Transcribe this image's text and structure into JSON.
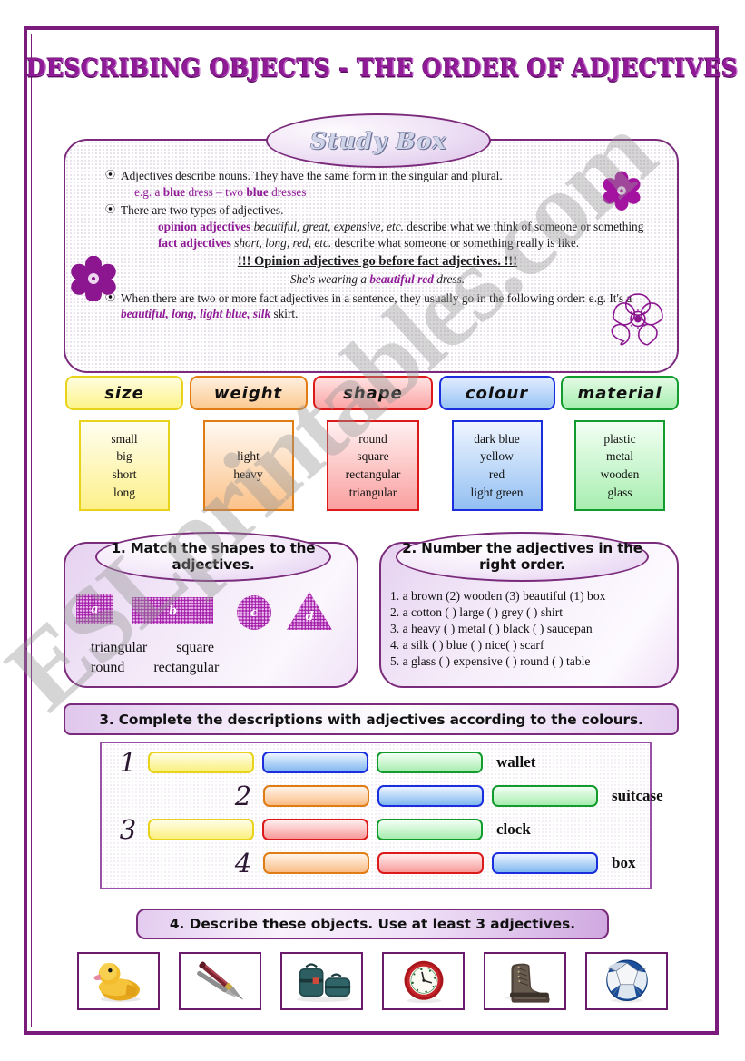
{
  "title": "DESCRIBING OBJECTS - THE ORDER OF ADJECTIVES",
  "watermark": "ESLprintables.com",
  "study_box": {
    "heading": "Study Box",
    "bullet1_main": "Adjectives describe nouns. They have the same form in the singular and plural.",
    "bullet1_eg_prefix": "e.g. a ",
    "bullet1_eg_b1": "blue",
    "bullet1_eg_mid": " dress – two ",
    "bullet1_eg_b2": "blue",
    "bullet1_eg_suffix": " dresses",
    "bullet2_main": "There are two types of adjectives.",
    "opinion_label": "opinion adjectives",
    "opinion_examples": "beautiful, great, expensive, etc.",
    "opinion_rest": " describe what we think of someone or something",
    "fact_label": "fact adjectives",
    "fact_examples": "short, long, red, etc.",
    "fact_rest": " describe what someone or something really is like.",
    "rule": "!!!  Opinion adjectives go before fact adjectives. !!!",
    "rule_example_pre": "She's wearing a ",
    "rule_example_bold": "beautiful red",
    "rule_example_post": " dress.",
    "bullet3_pre": "When there are two or more fact adjectives in a sentence, they usually go in the following order: e.g. It's a ",
    "bullet3_bold": "beautiful, long, light blue, silk",
    "bullet3_post": " skirt."
  },
  "categories": [
    {
      "name": "size",
      "items": [
        "small",
        "big",
        "short",
        "long"
      ],
      "head_border": "#e8d21a",
      "head_bg_from": "#fefce0",
      "head_bg_to": "#fdf48a",
      "list_border": "#e8d21a",
      "list_bg_from": "#fffef0",
      "list_bg_to": "#fdf08a",
      "head_w": 130,
      "list_w": 100,
      "list_h": 100
    },
    {
      "name": "weight",
      "items": [
        "light",
        "heavy"
      ],
      "head_border": "#e07c14",
      "head_bg_from": "#fff0e0",
      "head_bg_to": "#fbc990",
      "list_border": "#e07c14",
      "list_bg_from": "#fff9f2",
      "list_bg_to": "#fbc28a",
      "head_w": 130,
      "list_w": 100,
      "list_h": 100
    },
    {
      "name": "shape",
      "items": [
        "round",
        "square",
        "rectangular",
        "triangular"
      ],
      "head_border": "#dd1a1a",
      "head_bg_from": "#ffe2e2",
      "head_bg_to": "#fba5a5",
      "list_border": "#dd1a1a",
      "list_bg_from": "#fff0f0",
      "list_bg_to": "#fba0a0",
      "head_w": 132,
      "list_w": 102,
      "list_h": 100
    },
    {
      "name": "colour",
      "items": [
        "dark blue",
        "yellow",
        "red",
        "light green"
      ],
      "head_border": "#1a2edd",
      "head_bg_from": "#e2ecff",
      "head_bg_to": "#96c3f3",
      "list_border": "#1a2edd",
      "list_bg_from": "#eff5ff",
      "list_bg_to": "#93c0f2",
      "head_w": 128,
      "list_w": 100,
      "list_h": 100
    },
    {
      "name": "material",
      "items": [
        "plastic",
        "metal",
        "wooden",
        "glass"
      ],
      "head_border": "#139c2e",
      "head_bg_from": "#e4fae6",
      "head_bg_to": "#a6eeae",
      "list_border": "#139c2e",
      "list_bg_from": "#f2fff3",
      "list_bg_to": "#a8eeb0",
      "head_w": 130,
      "list_w": 100,
      "list_h": 100
    }
  ],
  "exercise1": {
    "heading": "1. Match the shapes to the adjectives.",
    "shapes": [
      {
        "label": "a",
        "kind": "square"
      },
      {
        "label": "b",
        "kind": "rectangle"
      },
      {
        "label": "c",
        "kind": "circle"
      },
      {
        "label": "d",
        "kind": "triangle"
      }
    ],
    "answers_line1": "triangular ___        square ___",
    "answers_line2": "round ___   rectangular ___"
  },
  "exercise2": {
    "heading": "2. Number the adjectives in the right order.",
    "items": [
      "1. a brown (2) wooden (3) beautiful (1) box",
      "2. a cotton (  ) large (  ) grey (  ) shirt",
      "3. a heavy (  ) metal (  ) black (  ) saucepan",
      "4. a silk (  ) blue (  ) nice(  ) scarf",
      "5.  a glass (  ) expensive (  ) round (  ) table"
    ]
  },
  "exercise3": {
    "heading": "3. Complete the descriptions with adjectives according to the colours.",
    "rows": [
      {
        "number": "1",
        "label": "wallet",
        "indent": 18,
        "bars": [
          {
            "color": "yellow",
            "border": "#e8d21a",
            "from": "#fffde8",
            "to": "#fbf07e"
          },
          {
            "color": "blue",
            "border": "#1a2edd",
            "from": "#eef5ff",
            "to": "#7fb7f0"
          },
          {
            "color": "green",
            "border": "#139c2e",
            "from": "#f4fff5",
            "to": "#a7edaf"
          }
        ]
      },
      {
        "number": "2",
        "label": "suitcase",
        "indent": 145,
        "bars": [
          {
            "color": "orange",
            "border": "#e07c14",
            "from": "#fff4ea",
            "to": "#f9bc85"
          },
          {
            "color": "blue",
            "border": "#1a2edd",
            "from": "#eef5ff",
            "to": "#7fb7f0"
          },
          {
            "color": "green",
            "border": "#139c2e",
            "from": "#f4fff5",
            "to": "#a7edaf"
          }
        ]
      },
      {
        "number": "3",
        "label": "clock",
        "indent": 18,
        "bars": [
          {
            "color": "yellow",
            "border": "#e8d21a",
            "from": "#fffde8",
            "to": "#fbf07e"
          },
          {
            "color": "red",
            "border": "#dd1a1a",
            "from": "#ffeeee",
            "to": "#f79a9a"
          },
          {
            "color": "green",
            "border": "#139c2e",
            "from": "#f4fff5",
            "to": "#a7edaf"
          }
        ]
      },
      {
        "number": "4",
        "label": "box",
        "indent": 145,
        "bars": [
          {
            "color": "orange",
            "border": "#e07c14",
            "from": "#fff4ea",
            "to": "#f9bc85"
          },
          {
            "color": "red",
            "border": "#dd1a1a",
            "from": "#ffeeee",
            "to": "#f79a9a"
          },
          {
            "color": "blue",
            "border": "#1a2edd",
            "from": "#eef5ff",
            "to": "#7fb7f0"
          }
        ]
      }
    ]
  },
  "exercise4": {
    "heading": "4. Describe these objects. Use at least 3 adjectives.",
    "objects": [
      "rubber-duck",
      "fountain-pen",
      "suitcases",
      "wall-clock",
      "leather-boot",
      "football"
    ]
  },
  "colors": {
    "purple_border": "#7b1b7b",
    "title_purple": "#8f1a96",
    "flower_purple": "#a3139f"
  }
}
